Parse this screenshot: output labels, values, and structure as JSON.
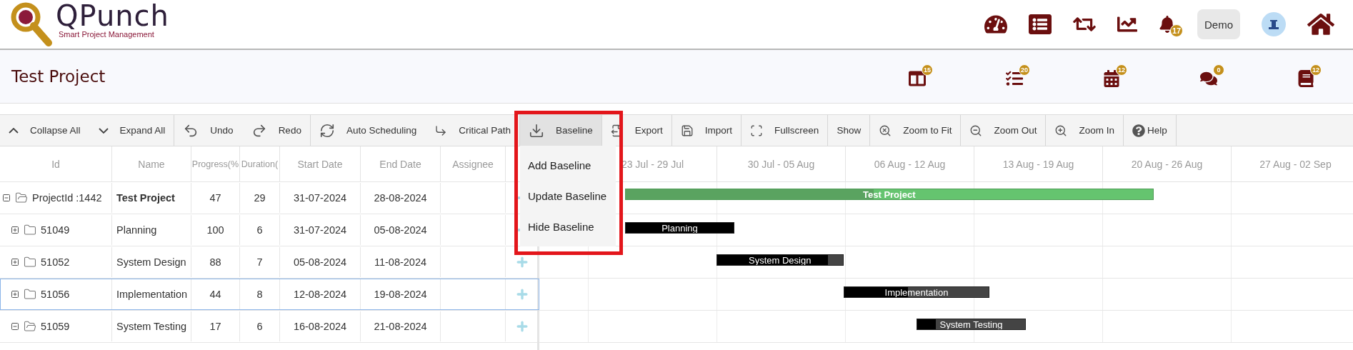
{
  "header": {
    "logo": {
      "name": "QPunch",
      "tagline": "Smart Project Management"
    },
    "notifications": "17",
    "user": "Demo"
  },
  "project": {
    "title": "Test Project",
    "badges": [
      {
        "kind": "columns",
        "count": "15"
      },
      {
        "kind": "tasks",
        "count": "20"
      },
      {
        "kind": "calendar",
        "count": "12"
      },
      {
        "kind": "comments",
        "count": "0"
      },
      {
        "kind": "book",
        "count": "12"
      }
    ]
  },
  "toolbar": [
    {
      "kind": "collapse",
      "label": "Collapse All",
      "group_end": false,
      "expanded": false
    },
    {
      "kind": "expand",
      "label": "Expand All",
      "group_end": true,
      "expanded": false
    },
    {
      "kind": "undo",
      "label": "Undo",
      "group_end": false,
      "expanded": false
    },
    {
      "kind": "redo",
      "label": "Redo",
      "group_end": true,
      "expanded": false
    },
    {
      "kind": "auto",
      "label": "Auto Scheduling",
      "group_end": false,
      "expanded": false
    },
    {
      "kind": "critical",
      "label": "Critical Path",
      "group_end": true,
      "expanded": false
    },
    {
      "kind": "baseline",
      "label": "Baseline",
      "group_end": true,
      "expanded": true,
      "menu": [
        "Add Baseline",
        "Update Baseline",
        "Hide Baseline"
      ]
    },
    {
      "kind": "export",
      "label": "Export",
      "group_end": true,
      "expanded": false
    },
    {
      "kind": "import",
      "label": "Import",
      "group_end": true,
      "expanded": false
    },
    {
      "kind": "fullscreen",
      "label": "Fullscreen",
      "group_end": true,
      "expanded": false
    },
    {
      "kind": "show",
      "label": "Show",
      "group_end": true,
      "expanded": false
    },
    {
      "kind": "fit",
      "label": "Zoom to Fit",
      "group_end": true,
      "expanded": false
    },
    {
      "kind": "zoomout",
      "label": "Zoom Out",
      "group_end": true,
      "expanded": false
    },
    {
      "kind": "zoomin",
      "label": "Zoom In",
      "group_end": true,
      "expanded": false
    },
    {
      "kind": "help",
      "label": "Help",
      "group_end": true,
      "expanded": false
    }
  ],
  "grid": {
    "columns": [
      "Id",
      "Name",
      "Progress(%",
      "Duration(",
      "Start Date",
      "End Date",
      "Assignee"
    ],
    "rows": [
      {
        "kind": "project",
        "expanded": true,
        "selected": false,
        "id": "ProjectId :1442",
        "name": "Test Project",
        "bar_label": "Test Project",
        "progress": "47",
        "duration": "29",
        "start": "31-07-2024",
        "end": "28-08-2024"
      },
      {
        "kind": "task",
        "expanded": false,
        "selected": false,
        "id": "51049",
        "name": "Planning",
        "bar_label": "Planning",
        "progress": "100",
        "duration": "6",
        "start": "31-07-2024",
        "end": "05-08-2024"
      },
      {
        "kind": "task",
        "expanded": false,
        "selected": false,
        "id": "51052",
        "name": "System Design",
        "bar_label": "System Design",
        "progress": "88",
        "duration": "7",
        "start": "05-08-2024",
        "end": "11-08-2024"
      },
      {
        "kind": "task",
        "expanded": false,
        "selected": true,
        "id": "51056",
        "name": "Implementation",
        "bar_label": "Implementation",
        "progress": "44",
        "duration": "8",
        "start": "12-08-2024",
        "end": "19-08-2024"
      },
      {
        "kind": "task",
        "expanded": true,
        "selected": false,
        "id": "51059",
        "name": "System Testing",
        "bar_label": "System Testing",
        "progress": "17",
        "duration": "6",
        "start": "16-08-2024",
        "end": "21-08-2024"
      }
    ]
  },
  "timeline": {
    "weeks": [
      "23 Jul - 29 Jul",
      "30 Jul - 05 Aug",
      "06 Aug - 12 Aug",
      "13 Aug - 19 Aug",
      "20 Aug - 26 Aug",
      "27 Aug - 02 Sep"
    ]
  }
}
